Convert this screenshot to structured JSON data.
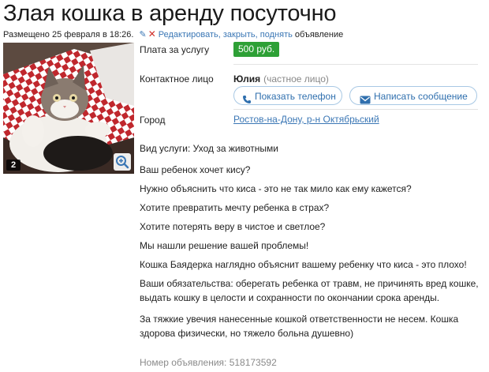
{
  "title": "Злая кошка в аренду посуточно",
  "meta": {
    "posted": "Размещено 25 февраля в 18:26.",
    "actions": [
      {
        "label": "Редактировать,"
      },
      {
        "label": "закрыть,"
      },
      {
        "label": "поднять"
      }
    ],
    "suffix": "объявление"
  },
  "photo": {
    "count": "2",
    "icons": [
      "zoom-icon"
    ]
  },
  "fields": {
    "price_label": "Плата за услугу",
    "price_value": "500 руб.",
    "contact_label": "Контактное лицо",
    "contact_name": "Юлия",
    "contact_kind": "(частное лицо)",
    "show_phone_label": "Показать телефон",
    "send_message_label": "Написать сообщение",
    "city_label": "Город",
    "city_value": "Ростов-на-Дону, р-н Октябрьский"
  },
  "description": [
    "Вид услуги: Уход за животными",
    "Ваш ребенок хочет кису?",
    "Нужно объяснить что киса - это не так мило как ему кажется?",
    "Хотите превратить мечту ребенка в страх?",
    "Хотите потерять веру в чистое и светлое?",
    "Мы нашли решение вашей проблемы!",
    "Кошка Баядерка наглядно объяснит вашему ребенку что киса - это плохо!",
    "Ваши обязательства: оберегать ребенка от травм, не причинять вред кошке,",
    "выдать кошку в целости и сохранности по окончании срока аренды.",
    "За тяжкие увечия нанесенные кошкой ответственности не несем. Кошка",
    "здорова физически, но тяжело больна душевно)"
  ],
  "ad_number": "Номер объявления: 518173592",
  "colors": {
    "link": "#3b77b5",
    "price_bg": "#2ea036",
    "pill_border": "#a8c8e4"
  }
}
